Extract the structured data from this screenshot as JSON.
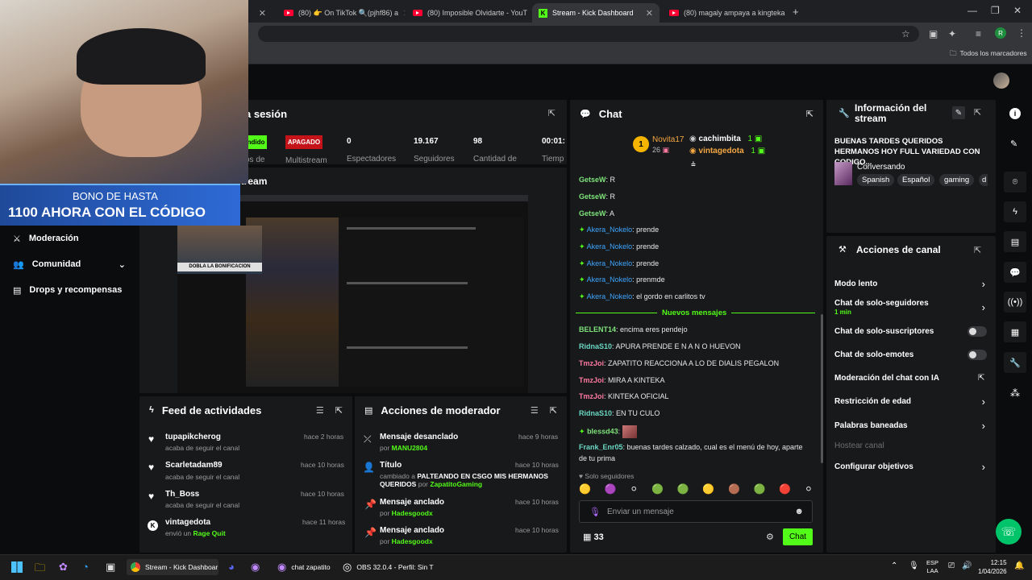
{
  "browser": {
    "tabs": [
      {
        "label": "(80) 👉 On TikTok 🔍(pjhf86) a"
      },
      {
        "label": "(80) Imposible Olvidarte - YouT"
      },
      {
        "label": "Stream - Kick Dashboard"
      },
      {
        "label": "(80) magaly ampaya a kingteka"
      }
    ],
    "bookmarks_label": "Todos los marcadores",
    "profile_initial": "R"
  },
  "overlay": {
    "bono_line1": "BONO DE HASTA",
    "bono_line2": "1100 AHORA CON EL CÓDIGO",
    "cam_caption": "DOBLA LA BONIFICACION"
  },
  "session": {
    "title_fragment": "a sesión",
    "status_partial": "ndido",
    "multistream_badge": "APAGADO",
    "stats": [
      {
        "value": "0",
        "label": "Espectadores"
      },
      {
        "value": "19.167",
        "label": "Seguidores"
      },
      {
        "value": "98",
        "label": "Cantidad de"
      },
      {
        "value": "00:01:",
        "label": "Tiemp"
      }
    ],
    "multistream_label": "Multistream",
    "label_partial": "os de"
  },
  "stream_preview": {
    "title_fragment": "stream"
  },
  "sidebar": {
    "items": [
      {
        "label": "Moderación"
      },
      {
        "label": "Comunidad"
      },
      {
        "label": "Drops y recompensas"
      }
    ]
  },
  "feed": {
    "title": "Feed de actividades",
    "items": [
      {
        "name": "tupapikcherog",
        "sub": "acaba de seguir el canal",
        "time": "hace 2 horas"
      },
      {
        "name": "Scarletadam89",
        "sub": "acaba de seguir el canal",
        "time": "hace 10 horas"
      },
      {
        "name": "Th_Boss",
        "sub": "acaba de seguir el canal",
        "time": "hace 10 horas"
      },
      {
        "name": "vintagedota",
        "sub": "envió un",
        "sub_highlight": "Rage Quit",
        "time": "hace 11 horas"
      }
    ]
  },
  "modactions": {
    "title": "Acciones de moderador",
    "items": [
      {
        "title": "Mensaje desanclado",
        "by": "por",
        "user": "MANU2804",
        "time": "hace 9 horas"
      },
      {
        "title": "Título",
        "by": "cambiado a",
        "detail": "PALTEANDO EN CSGO MIS HERMANOS QUERIDOS",
        "by2": "por",
        "user": "ZapatitoGaming",
        "time": "hace 10 horas"
      },
      {
        "title": "Mensaje anclado",
        "by": "por",
        "user": "Hadesgoodx",
        "time": "hace 10 horas"
      },
      {
        "title": "Mensaje anclado",
        "by": "por",
        "user": "Hadesgoodx",
        "time": "hace 10 horas"
      }
    ]
  },
  "chat": {
    "title": "Chat",
    "top_gifters": [
      {
        "rank": "1",
        "name": "Novita17",
        "count": "26"
      },
      {
        "name": "cachimbita",
        "count": "1"
      },
      {
        "name": "vintagedota",
        "count": "1"
      }
    ],
    "messages_old": [
      {
        "user": "GetseW",
        "text": ": R"
      },
      {
        "user": "GetseW",
        "text": ": R"
      },
      {
        "user": "GetseW",
        "text": ": A"
      },
      {
        "user": "Akera_Nokelo",
        "text": ": prende"
      },
      {
        "user": "Akera_Nokelo",
        "text": ": prende"
      },
      {
        "user": "Akera_Nokelo",
        "text": ": prende"
      },
      {
        "user": "Akera_Nokelo",
        "text": ": prenmde"
      },
      {
        "user": "Akera_Nokelo",
        "text": ": el gordo en carlitos tv"
      }
    ],
    "new_divider": "Nuevos mensajes",
    "messages_new": [
      {
        "user": "BELENT14",
        "text": ": encima eres pendejo"
      },
      {
        "user": "RidnaS10",
        "text": ": APURA PRENDE E N A N O HUEVON"
      },
      {
        "user": "TmzJoi",
        "text": ": ZAPATITO REACCIONA A LO DE DIALIS PEGALON"
      },
      {
        "user": "TmzJoi",
        "text": ": MIRA A KINTEKA"
      },
      {
        "user": "TmzJoi",
        "text": ": KINTEKA OFICIAL"
      },
      {
        "user": "RidnaS10",
        "text": ": EN TU CULO"
      },
      {
        "user": "blessd43",
        "text": ":"
      },
      {
        "user": "Frank_Enr05",
        "text": ": buenas tardes calzado, cual es el menú de hoy, aparte"
      },
      {
        "user": "",
        "text": "de tu prima"
      }
    ],
    "followers_only": "Solo seguidores",
    "input_placeholder": "Enviar un mensaje",
    "viewer_count": "33",
    "send_label": "Chat"
  },
  "streaminfo": {
    "title_line1": "Información del",
    "title_line2": "stream",
    "stream_title": "BUENAS TARDES QUERIDOS HERMANOS HOY FULL VARIEDAD CON CODIGO...",
    "category": "Conversando",
    "tags": [
      "Spanish",
      "Español",
      "gaming",
      "d"
    ]
  },
  "channel_actions": {
    "title": "Acciones de canal",
    "items": [
      {
        "label": "Modo lento"
      },
      {
        "label": "Chat de solo-seguidores",
        "sub": "1 min"
      },
      {
        "label": "Chat de solo-suscriptores"
      },
      {
        "label": "Chat de solo-emotes"
      },
      {
        "label": "Moderación del chat con IA"
      },
      {
        "label": "Restricción de edad"
      },
      {
        "label": "Palabras baneadas"
      },
      {
        "label": "Hostear canal"
      },
      {
        "label": "Configurar objetivos"
      }
    ]
  },
  "taskbar": {
    "apps": [
      {
        "label": "Stream - Kick Dashboar"
      },
      {
        "label": "chat zapatito"
      },
      {
        "label": "OBS 32.0.4 - Perfil: Sin T"
      }
    ],
    "lang": "ESP",
    "lang2": "LAA",
    "time": "12:15",
    "date": "1/04/2026"
  },
  "colors": {
    "kick_green": "#53fc18",
    "badge_red": "#c4141a",
    "panel_bg": "#18191b"
  }
}
